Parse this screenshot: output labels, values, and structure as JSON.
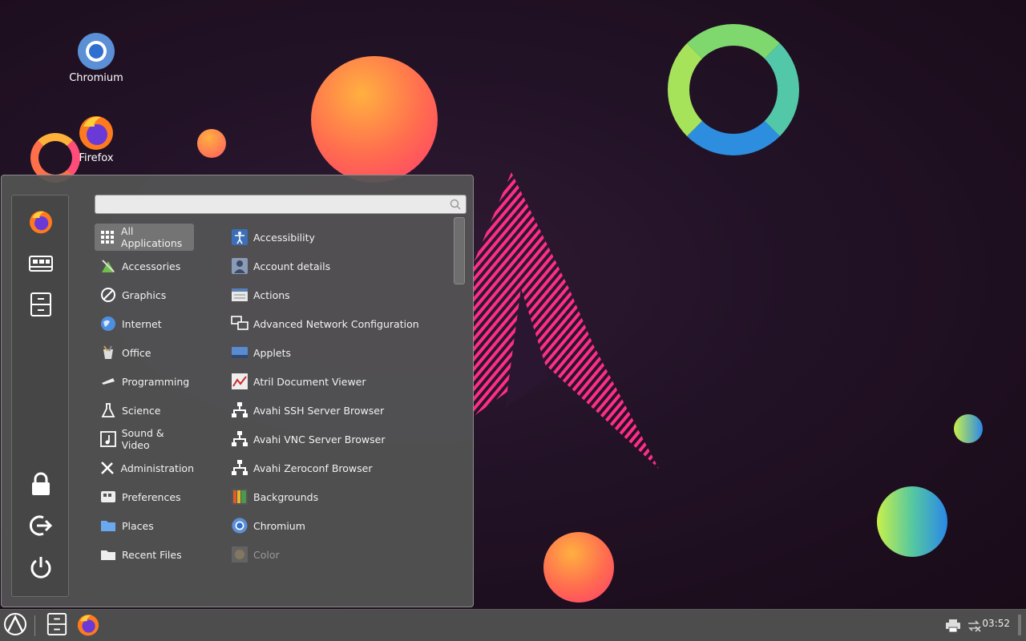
{
  "desktop": {
    "icons": [
      {
        "label": "Chromium",
        "icon": "chromium-icon"
      },
      {
        "label": "Firefox",
        "icon": "firefox-icon"
      }
    ]
  },
  "menu": {
    "search": {
      "value": "",
      "placeholder": ""
    },
    "favorites": [
      {
        "name": "firefox",
        "icon": "firefox-icon"
      },
      {
        "name": "control-center",
        "icon": "control-center-icon"
      },
      {
        "name": "file-manager",
        "icon": "file-cabinet-icon"
      }
    ],
    "session_buttons": [
      {
        "name": "lock",
        "icon": "lock-icon"
      },
      {
        "name": "logout",
        "icon": "logout-icon"
      },
      {
        "name": "shutdown",
        "icon": "power-icon"
      }
    ],
    "categories": [
      {
        "label": "All Applications",
        "icon": "grid-icon",
        "selected": true
      },
      {
        "label": "Accessories",
        "icon": "accessories-icon"
      },
      {
        "label": "Graphics",
        "icon": "graphics-icon"
      },
      {
        "label": "Internet",
        "icon": "globe-icon"
      },
      {
        "label": "Office",
        "icon": "office-icon"
      },
      {
        "label": "Programming",
        "icon": "programming-icon"
      },
      {
        "label": "Science",
        "icon": "flask-icon"
      },
      {
        "label": "Sound & Video",
        "icon": "sound-video-icon"
      },
      {
        "label": "Administration",
        "icon": "tools-icon"
      },
      {
        "label": "Preferences",
        "icon": "preferences-icon"
      },
      {
        "label": "Places",
        "icon": "folder-icon"
      },
      {
        "label": "Recent Files",
        "icon": "recent-files-icon"
      }
    ],
    "apps": [
      {
        "label": "Accessibility",
        "icon": "accessibility-icon"
      },
      {
        "label": "Account details",
        "icon": "account-icon"
      },
      {
        "label": "Actions",
        "icon": "actions-icon"
      },
      {
        "label": "Advanced Network Configuration",
        "icon": "network-icon"
      },
      {
        "label": "Applets",
        "icon": "applets-icon"
      },
      {
        "label": "Atril Document Viewer",
        "icon": "document-viewer-icon"
      },
      {
        "label": "Avahi SSH Server Browser",
        "icon": "avahi-network-icon"
      },
      {
        "label": "Avahi VNC Server Browser",
        "icon": "avahi-network-icon"
      },
      {
        "label": "Avahi Zeroconf Browser",
        "icon": "avahi-network-icon"
      },
      {
        "label": "Backgrounds",
        "icon": "backgrounds-icon"
      },
      {
        "label": "Chromium",
        "icon": "chromium-icon"
      },
      {
        "label": "Color",
        "icon": "color-icon",
        "dim": true
      }
    ]
  },
  "panel": {
    "clock": "03:52",
    "tray": [
      {
        "icon": "printer-icon"
      },
      {
        "icon": "network-disconnected-icon"
      }
    ]
  },
  "colors": {
    "accent_pink": "#ff2d87",
    "menu_bg": "#545454",
    "panel_bg": "#4d4d4d"
  }
}
